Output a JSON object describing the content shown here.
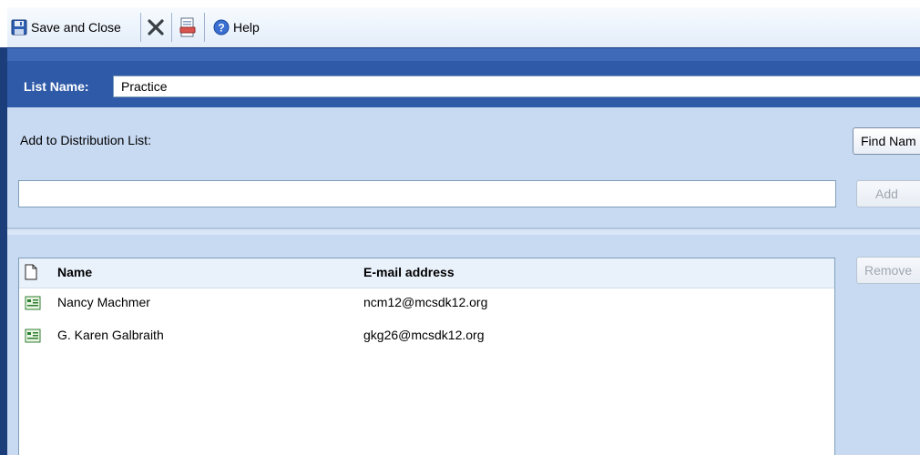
{
  "toolbar": {
    "save_label": "Save and Close",
    "help_label": "Help"
  },
  "list_name": {
    "label": "List Name:",
    "value": "Practice"
  },
  "distribution": {
    "label": "Add to Distribution List:",
    "input_value": "",
    "find_button": "Find Nam",
    "add_button": "Add",
    "remove_button": "Remove"
  },
  "members": {
    "columns": {
      "name": "Name",
      "email": "E-mail address"
    },
    "rows": [
      {
        "name": "Nancy Machmer",
        "email": "ncm12@mcsdk12.org"
      },
      {
        "name": "G. Karen Galbraith",
        "email": "gkg26@mcsdk12.org"
      }
    ]
  },
  "colors": {
    "header_band": "#2f5aa8",
    "panel": "#c8daf2",
    "toolbar": "#e3edf9"
  }
}
